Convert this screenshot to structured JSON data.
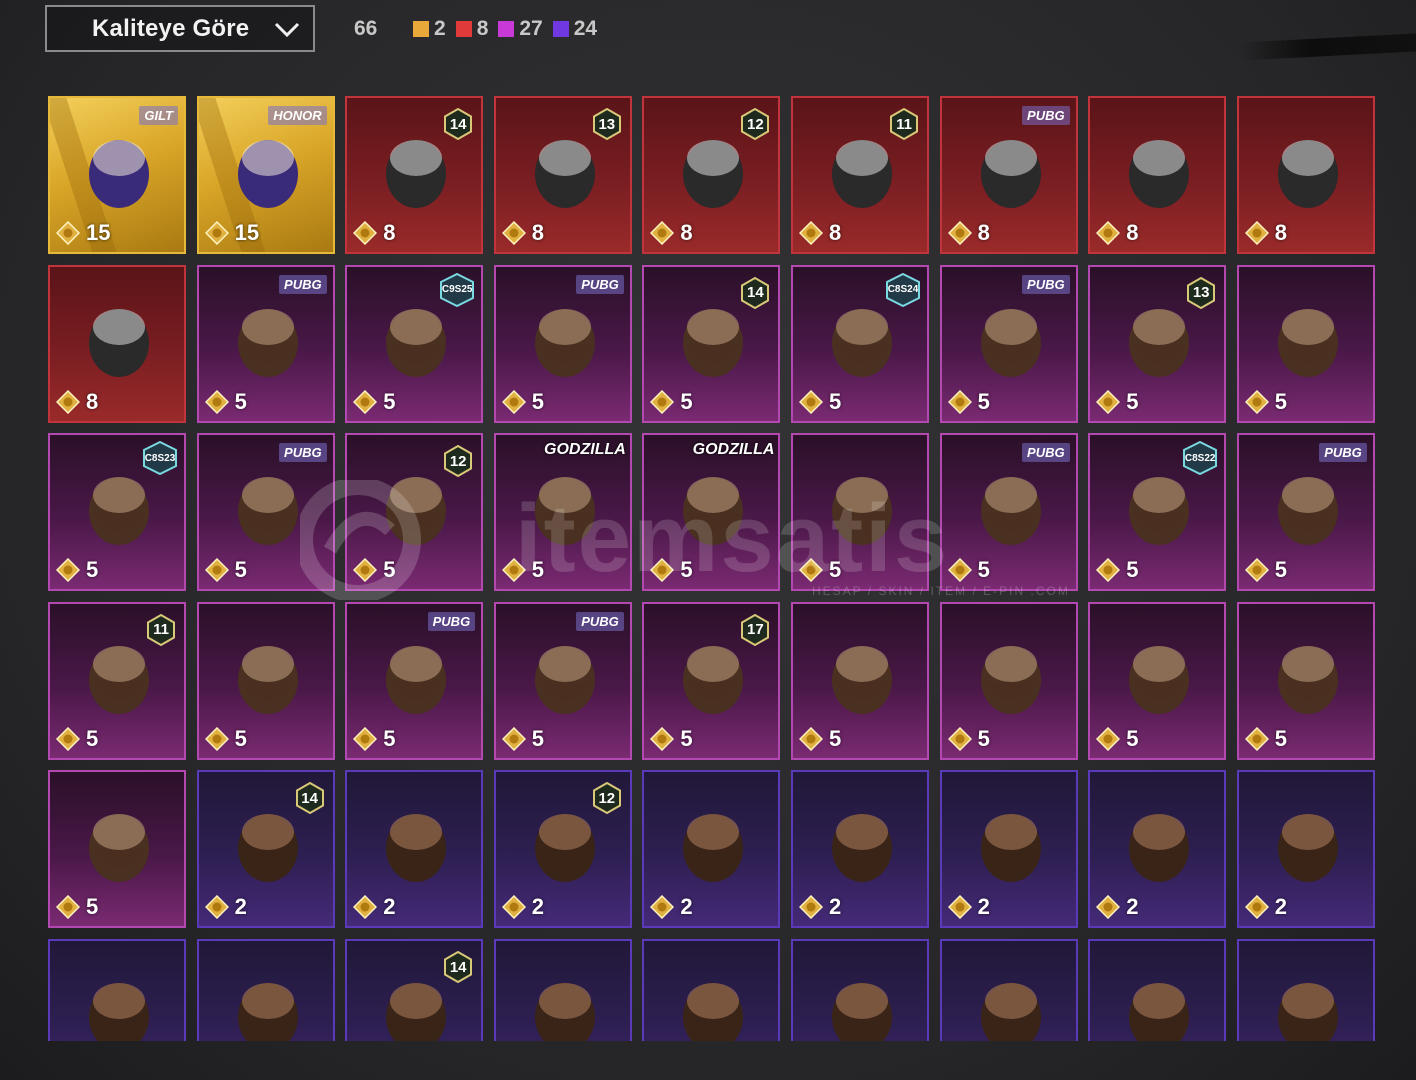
{
  "header": {
    "sort_label": "Kaliteye Göre",
    "total": "66",
    "rarity_counts": [
      {
        "value": "2",
        "color": "#e8a83a"
      },
      {
        "value": "8",
        "color": "#e03a3a"
      },
      {
        "value": "27",
        "color": "#c83ad8"
      },
      {
        "value": "24",
        "color": "#7038e0"
      }
    ]
  },
  "watermark": {
    "text": "itemsatis",
    "sub": "HESAP / SKIN / ITEM / E-PIN .COM"
  },
  "items": [
    {
      "rarity": "gold",
      "price": "15",
      "badge": "GILT",
      "icon": "skull-jester-hat-icon"
    },
    {
      "rarity": "gold",
      "price": "15",
      "badge": "HONOR",
      "icon": "chandelier-hat-icon"
    },
    {
      "rarity": "red",
      "price": "8",
      "tier": "14",
      "icon": "wolf-mask-icon"
    },
    {
      "rarity": "red",
      "price": "8",
      "tier": "13",
      "icon": "witch-hat-hair-icon"
    },
    {
      "rarity": "red",
      "price": "8",
      "tier": "12",
      "icon": "bunny-ear-hair-icon"
    },
    {
      "rarity": "red",
      "price": "8",
      "tier": "11",
      "icon": "black-hair-icon"
    },
    {
      "rarity": "red",
      "price": "8",
      "badge": "PUBG",
      "icon": "lilac-hair-icon"
    },
    {
      "rarity": "red",
      "price": "8",
      "icon": "oni-mask-icon"
    },
    {
      "rarity": "red",
      "price": "8",
      "icon": "feather-helmet-icon"
    },
    {
      "rarity": "red",
      "price": "8",
      "icon": "pharaoh-helmet-icon"
    },
    {
      "rarity": "pink",
      "price": "5",
      "badge": "PUBG",
      "icon": "bow-headband-icon"
    },
    {
      "rarity": "pink",
      "price": "5",
      "season": "C9S25",
      "icon": "silver-hair-icon"
    },
    {
      "rarity": "pink",
      "price": "5",
      "badge": "PUBG",
      "icon": "box-mask-icon"
    },
    {
      "rarity": "pink",
      "price": "5",
      "tier": "14",
      "icon": "blonde-flower-hair-icon"
    },
    {
      "rarity": "pink",
      "price": "5",
      "season": "C8S24",
      "icon": "dark-bob-hair-icon"
    },
    {
      "rarity": "pink",
      "price": "5",
      "badge": "PUBG",
      "icon": "ribbon-hair-icon"
    },
    {
      "rarity": "pink",
      "price": "5",
      "tier": "13",
      "icon": "goggles-hair-icon"
    },
    {
      "rarity": "pink",
      "price": "5",
      "icon": "cap-hair-icon"
    },
    {
      "rarity": "pink",
      "price": "5",
      "season": "C8S23",
      "icon": "cat-headphones-icon"
    },
    {
      "rarity": "pink",
      "price": "5",
      "badge": "PUBG",
      "icon": "cap-glasses-icon"
    },
    {
      "rarity": "pink",
      "price": "5",
      "tier": "12",
      "icon": "ginger-pigtail-hair-icon"
    },
    {
      "rarity": "pink",
      "price": "5",
      "logo": "GODZILLA",
      "icon": "spiked-cap-icon"
    },
    {
      "rarity": "pink",
      "price": "5",
      "logo": "GODZILLA",
      "icon": "blue-spiky-hair-icon"
    },
    {
      "rarity": "pink",
      "price": "5",
      "icon": "blue-cat-ponytail-icon"
    },
    {
      "rarity": "pink",
      "price": "5",
      "badge": "PUBG",
      "icon": "alpaca-mask-icon"
    },
    {
      "rarity": "pink",
      "price": "5",
      "season": "C8S22",
      "icon": "purple-teal-hair-icon"
    },
    {
      "rarity": "pink",
      "price": "5",
      "badge": "PUBG",
      "icon": "panda-mask-icon"
    },
    {
      "rarity": "pink",
      "price": "5",
      "tier": "11",
      "icon": "flower-beanie-hair-icon"
    },
    {
      "rarity": "pink",
      "price": "5",
      "icon": "thin-braid-icon"
    },
    {
      "rarity": "pink",
      "price": "5",
      "badge": "PUBG",
      "icon": "brown-bun-hair-icon"
    },
    {
      "rarity": "pink",
      "price": "5",
      "badge": "PUBG",
      "icon": "panther-mask-icon"
    },
    {
      "rarity": "pink",
      "price": "5",
      "tier": "17",
      "icon": "antler-mask-icon"
    },
    {
      "rarity": "pink",
      "price": "5",
      "icon": "gas-mask-helmet-icon"
    },
    {
      "rarity": "pink",
      "price": "5",
      "icon": "shako-hat-icon"
    },
    {
      "rarity": "pink",
      "price": "5",
      "icon": "gold-lion-helmet-icon"
    },
    {
      "rarity": "pink",
      "price": "5",
      "icon": "red-hair-cap-icon"
    },
    {
      "rarity": "pink",
      "price": "5",
      "icon": "flower-top-hat-icon"
    },
    {
      "rarity": "violet",
      "price": "2",
      "tier": "14",
      "icon": "cat-cap-hair-icon"
    },
    {
      "rarity": "violet",
      "price": "2",
      "icon": "beret-hair-icon"
    },
    {
      "rarity": "violet",
      "price": "2",
      "tier": "12",
      "icon": "bunny-helmet-icon"
    },
    {
      "rarity": "violet",
      "price": "2",
      "icon": "goggles-red-hair-icon"
    },
    {
      "rarity": "violet",
      "price": "2",
      "icon": "blonde-wavy-hair-icon"
    },
    {
      "rarity": "violet",
      "price": "2",
      "icon": "red-mohawk-icon"
    },
    {
      "rarity": "violet",
      "price": "2",
      "icon": "football-helmet-icon"
    },
    {
      "rarity": "violet",
      "price": "2",
      "icon": "visor-braid-helmet-icon"
    },
    {
      "rarity": "violet",
      "icon": "dark-hair-icon"
    },
    {
      "rarity": "violet",
      "icon": "mushroom-hat-icon"
    },
    {
      "rarity": "violet",
      "tier": "14",
      "icon": "officer-cap-icon"
    },
    {
      "rarity": "violet",
      "icon": "white-hood-icon"
    },
    {
      "rarity": "violet",
      "icon": "luchador-mask-icon"
    },
    {
      "rarity": "violet",
      "icon": "shark-hat-icon"
    },
    {
      "rarity": "violet",
      "icon": "red-beret-icon"
    },
    {
      "rarity": "violet",
      "icon": "black-bowler-icon"
    },
    {
      "rarity": "violet",
      "icon": "red-fedora-icon"
    }
  ]
}
